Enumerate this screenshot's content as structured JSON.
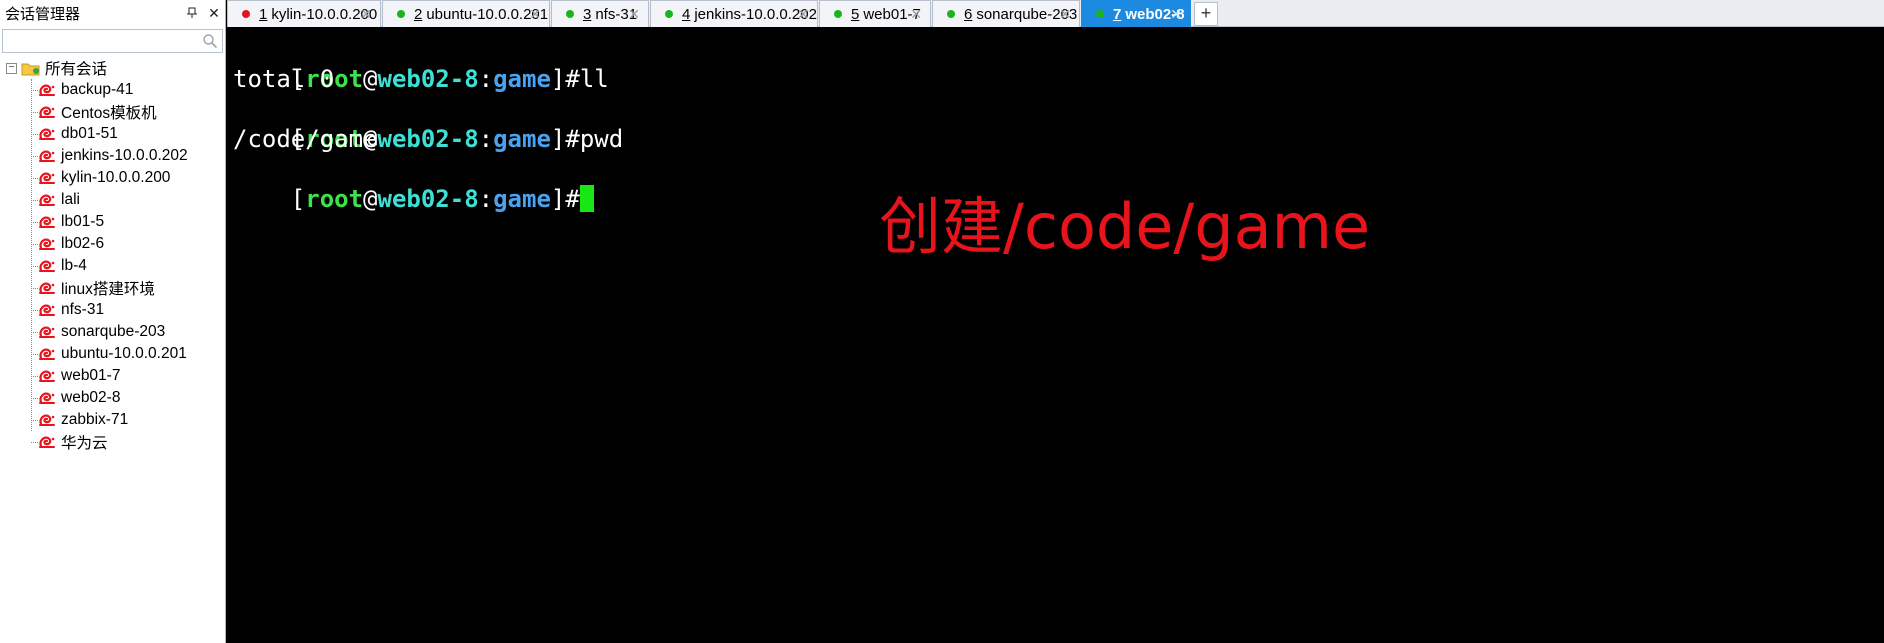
{
  "sidebar": {
    "title": "会话管理器",
    "search_placeholder": "",
    "root_label": "所有会话",
    "items": [
      {
        "label": "backup-41"
      },
      {
        "label": "Centos模板机"
      },
      {
        "label": "db01-51"
      },
      {
        "label": "jenkins-10.0.0.202"
      },
      {
        "label": "kylin-10.0.0.200"
      },
      {
        "label": "lali"
      },
      {
        "label": "lb01-5"
      },
      {
        "label": "lb02-6"
      },
      {
        "label": "lb-4"
      },
      {
        "label": "linux搭建环境"
      },
      {
        "label": "nfs-31"
      },
      {
        "label": "sonarqube-203"
      },
      {
        "label": "ubuntu-10.0.0.201"
      },
      {
        "label": "web01-7"
      },
      {
        "label": "web02-8"
      },
      {
        "label": "zabbix-71"
      },
      {
        "label": "华为云"
      }
    ]
  },
  "tabs": [
    {
      "num": "1",
      "label": "kylin-10.0.0.200",
      "status": "red",
      "active": false
    },
    {
      "num": "2",
      "label": "ubuntu-10.0.0.201",
      "status": "green",
      "active": false
    },
    {
      "num": "3",
      "label": "nfs-31",
      "status": "green",
      "active": false
    },
    {
      "num": "4",
      "label": "jenkins-10.0.0.202",
      "status": "green",
      "active": false
    },
    {
      "num": "5",
      "label": "web01-7",
      "status": "green",
      "active": false
    },
    {
      "num": "6",
      "label": "sonarqube-203",
      "status": "green",
      "active": false
    },
    {
      "num": "7",
      "label": "web02-8",
      "status": "green",
      "active": true
    }
  ],
  "colors": {
    "status_red": "#e8141c",
    "status_green": "#19b51f",
    "active_tab": "#1b8ae0",
    "prompt_user": "#3ee34b",
    "prompt_host": "#3ee0d6",
    "prompt_dir": "#4aa3f0",
    "annotation": "#e8141c"
  },
  "terminal": {
    "prompt": {
      "open": "[",
      "user": "root",
      "at": "@",
      "host": "web02-8",
      "colon": ":",
      "dir": "game",
      "close": "]#"
    },
    "cmd1": "ll",
    "out1": "total 0",
    "cmd2": "pwd",
    "out2": "/code/game"
  },
  "annotation": "创建/code/game"
}
